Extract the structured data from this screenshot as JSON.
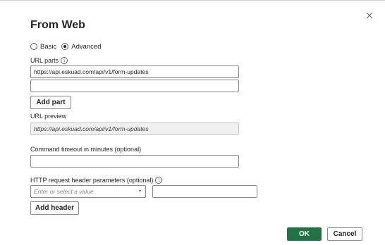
{
  "dialog": {
    "title": "From Web",
    "close_glyph": "×"
  },
  "mode": {
    "options": [
      {
        "label": "Basic",
        "selected": false
      },
      {
        "label": "Advanced",
        "selected": true
      }
    ]
  },
  "url_parts": {
    "label": "URL parts",
    "info_glyph": "i",
    "part1_value": "https://api.eskuad.com/api/v1/form-updates",
    "part2_value": "",
    "add_part_label": "Add part"
  },
  "url_preview": {
    "label": "URL preview",
    "value": "https://api.eskuad.com/api/v1/form-updates"
  },
  "timeout": {
    "label": "Command timeout in minutes (optional)",
    "value": ""
  },
  "http_headers": {
    "label": "HTTP request header parameters (optional)",
    "info_glyph": "i",
    "key_placeholder": "Enter or select a value",
    "chevron_glyph": "▾",
    "value": "",
    "add_header_label": "Add header"
  },
  "footer": {
    "ok_label": "OK",
    "cancel_label": "Cancel"
  },
  "colors": {
    "primary": "#217346",
    "border": "#8a8886",
    "readonly_bg": "#f0f0f0"
  }
}
